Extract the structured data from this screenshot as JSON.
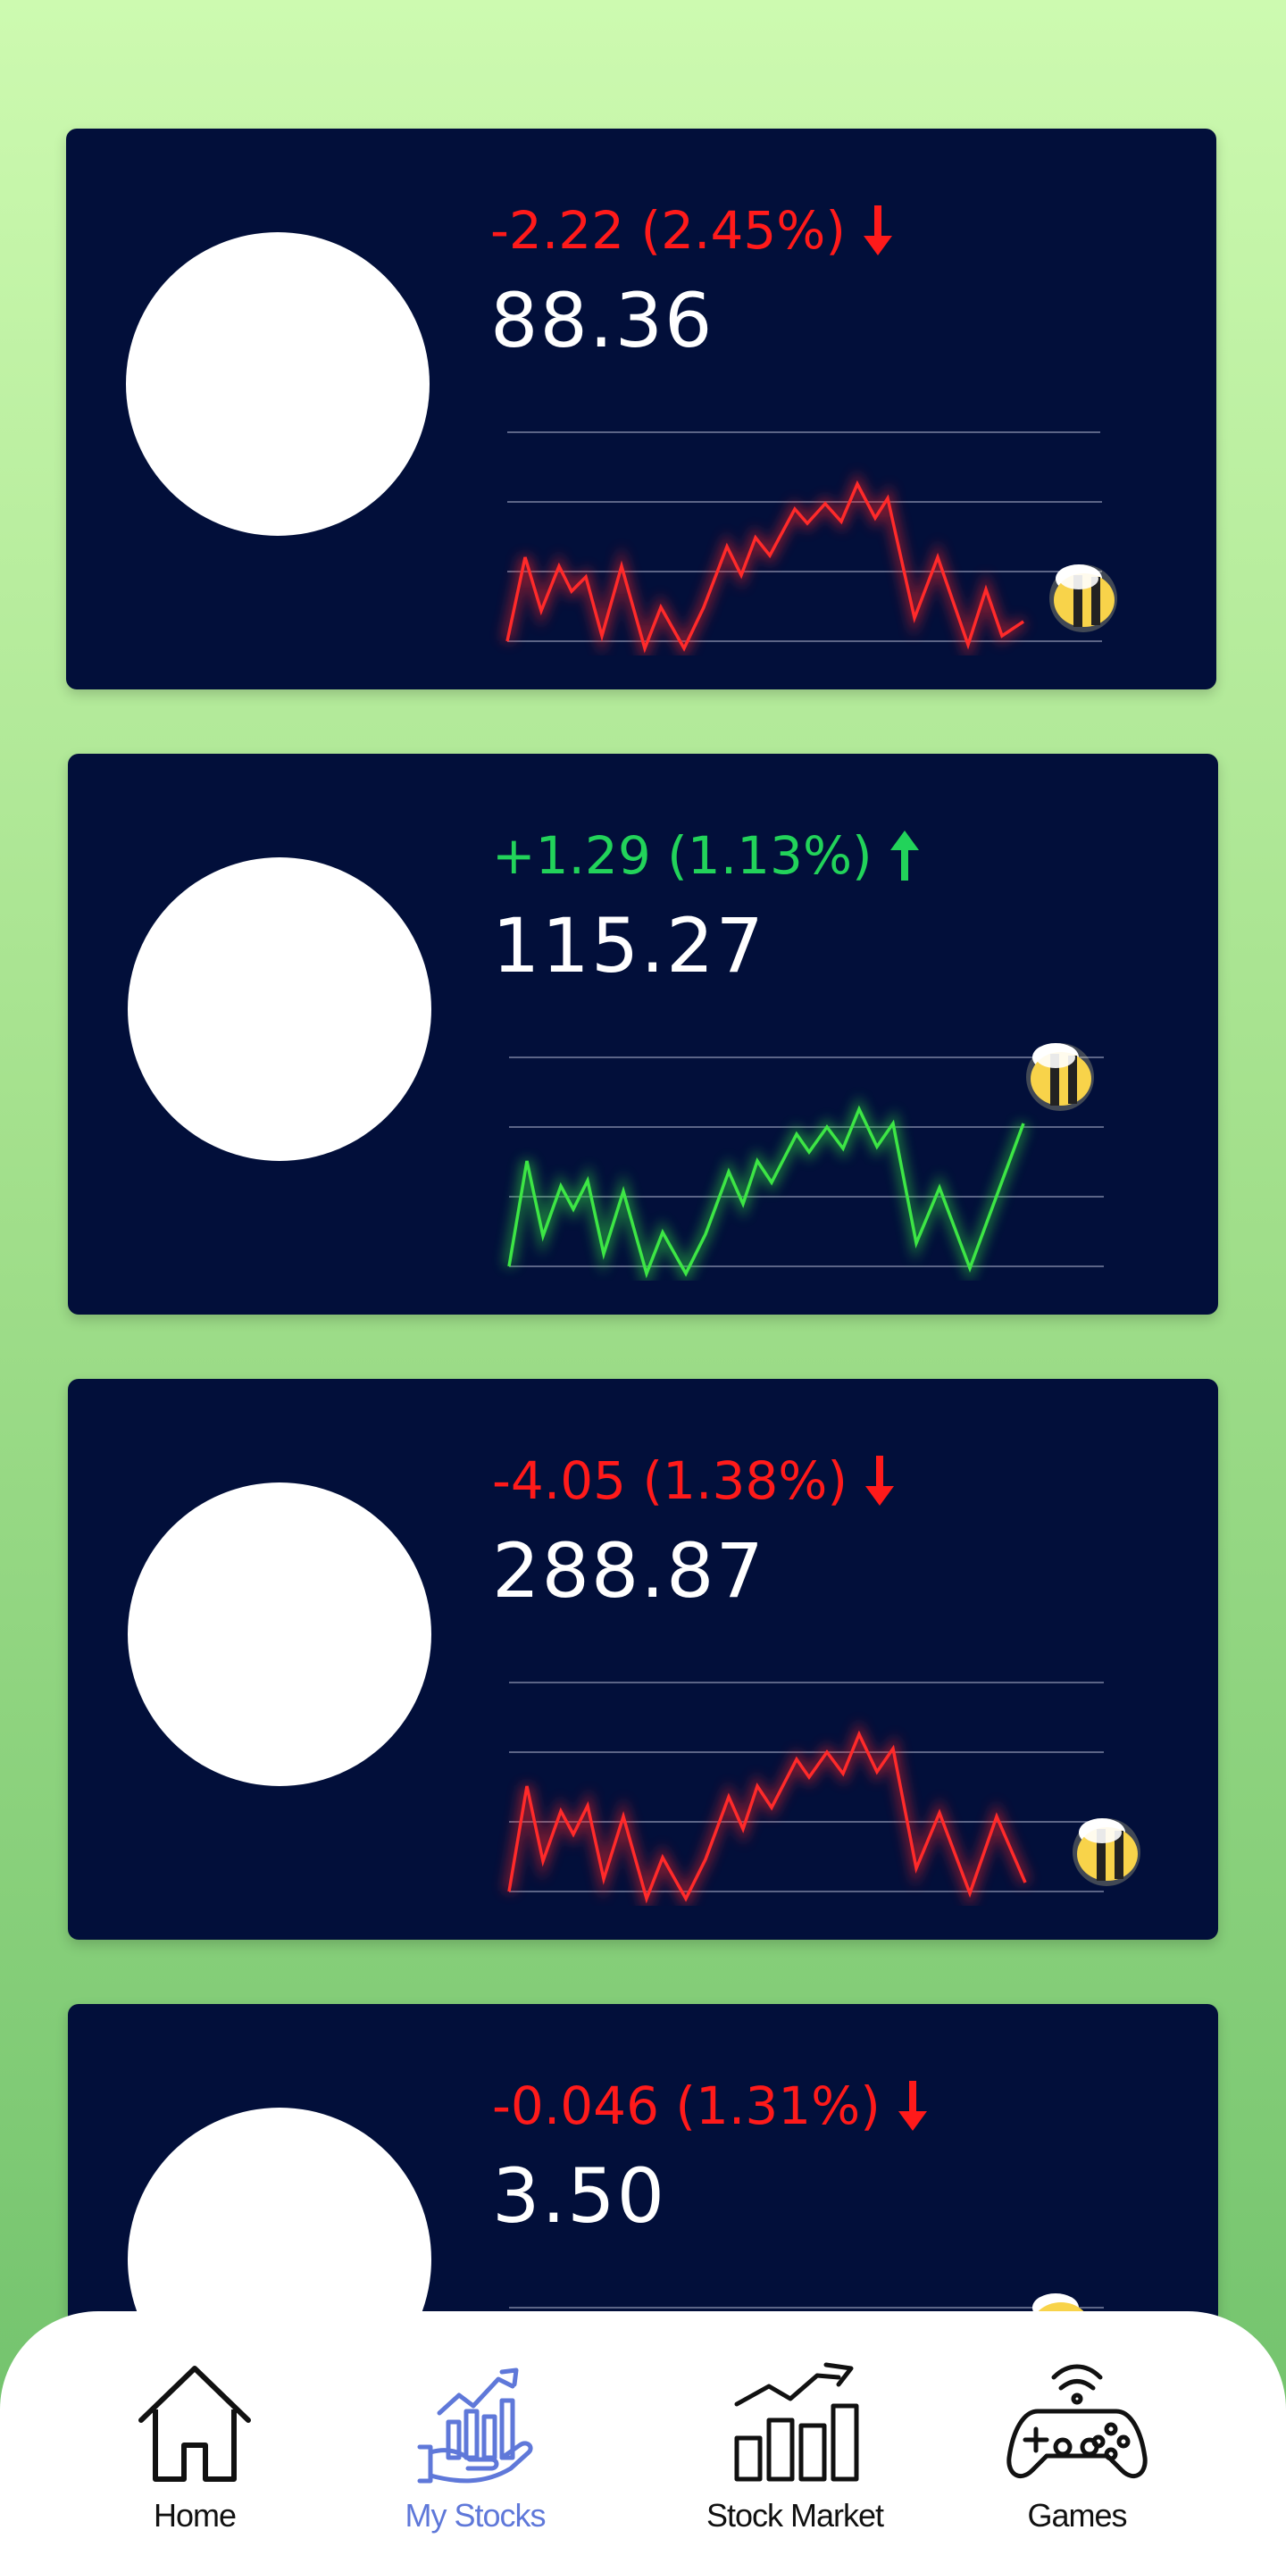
{
  "stocks": [
    {
      "change": "-2.22 (2.45%)",
      "price": "88.36",
      "direction": "down",
      "color": "#ff1a1a"
    },
    {
      "change": "+1.29 (1.13%)",
      "price": "115.27",
      "direction": "up",
      "color": "#22d35a"
    },
    {
      "change": "-4.05 (1.38%)",
      "price": "288.87",
      "direction": "down",
      "color": "#ff1a1a"
    },
    {
      "change": "-0.046 (1.31%)",
      "price": "3.50",
      "direction": "down",
      "color": "#ff1a1a"
    }
  ],
  "nav": {
    "home": "Home",
    "my_stocks": "My Stocks",
    "stock_market": "Stock Market",
    "games": "Games",
    "active": "my_stocks",
    "active_color": "#5f78d9"
  }
}
